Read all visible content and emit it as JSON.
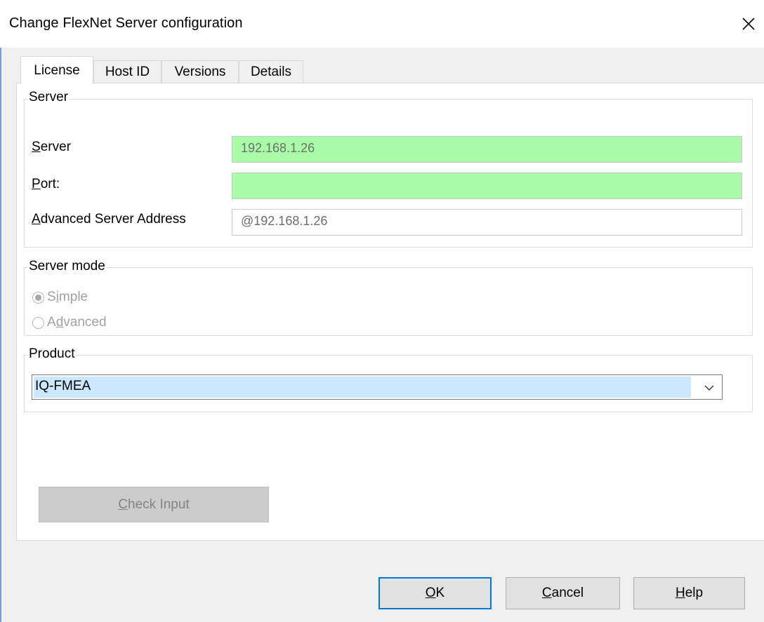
{
  "window": {
    "title": "Change FlexNet Server configuration",
    "close_symbol": "✕"
  },
  "tabs": [
    {
      "label": "License",
      "active": true
    },
    {
      "label": "Host ID",
      "active": false
    },
    {
      "label": "Versions",
      "active": false
    },
    {
      "label": "Details",
      "active": false
    }
  ],
  "server_group": {
    "title": "Server",
    "server_label_first": "S",
    "server_label_rest": "erver",
    "server_value": "192.168.1.26",
    "port_label_first": "P",
    "port_label_rest": "ort:",
    "port_value": "",
    "advanced_label_first": "A",
    "advanced_label_rest": "dvanced Server Address",
    "advanced_value": "@192.168.1.26",
    "field_highlight_color": "#a9fda9"
  },
  "server_mode": {
    "title": "Server mode",
    "simple_pre": "S",
    "simple_u": "i",
    "simple_post": "mple",
    "advanced_pre": "A",
    "advanced_u": "d",
    "advanced_post": "vanced",
    "selected": "Simple"
  },
  "product": {
    "title": "Product",
    "selected_value": "IQ-FMEA"
  },
  "buttons": {
    "check_input_u": "C",
    "check_input_rest": "heck Input",
    "ok_u": "O",
    "ok_rest": "K",
    "cancel_u": "C",
    "cancel_rest": "ancel",
    "help_u": "H",
    "help_rest": "elp"
  }
}
